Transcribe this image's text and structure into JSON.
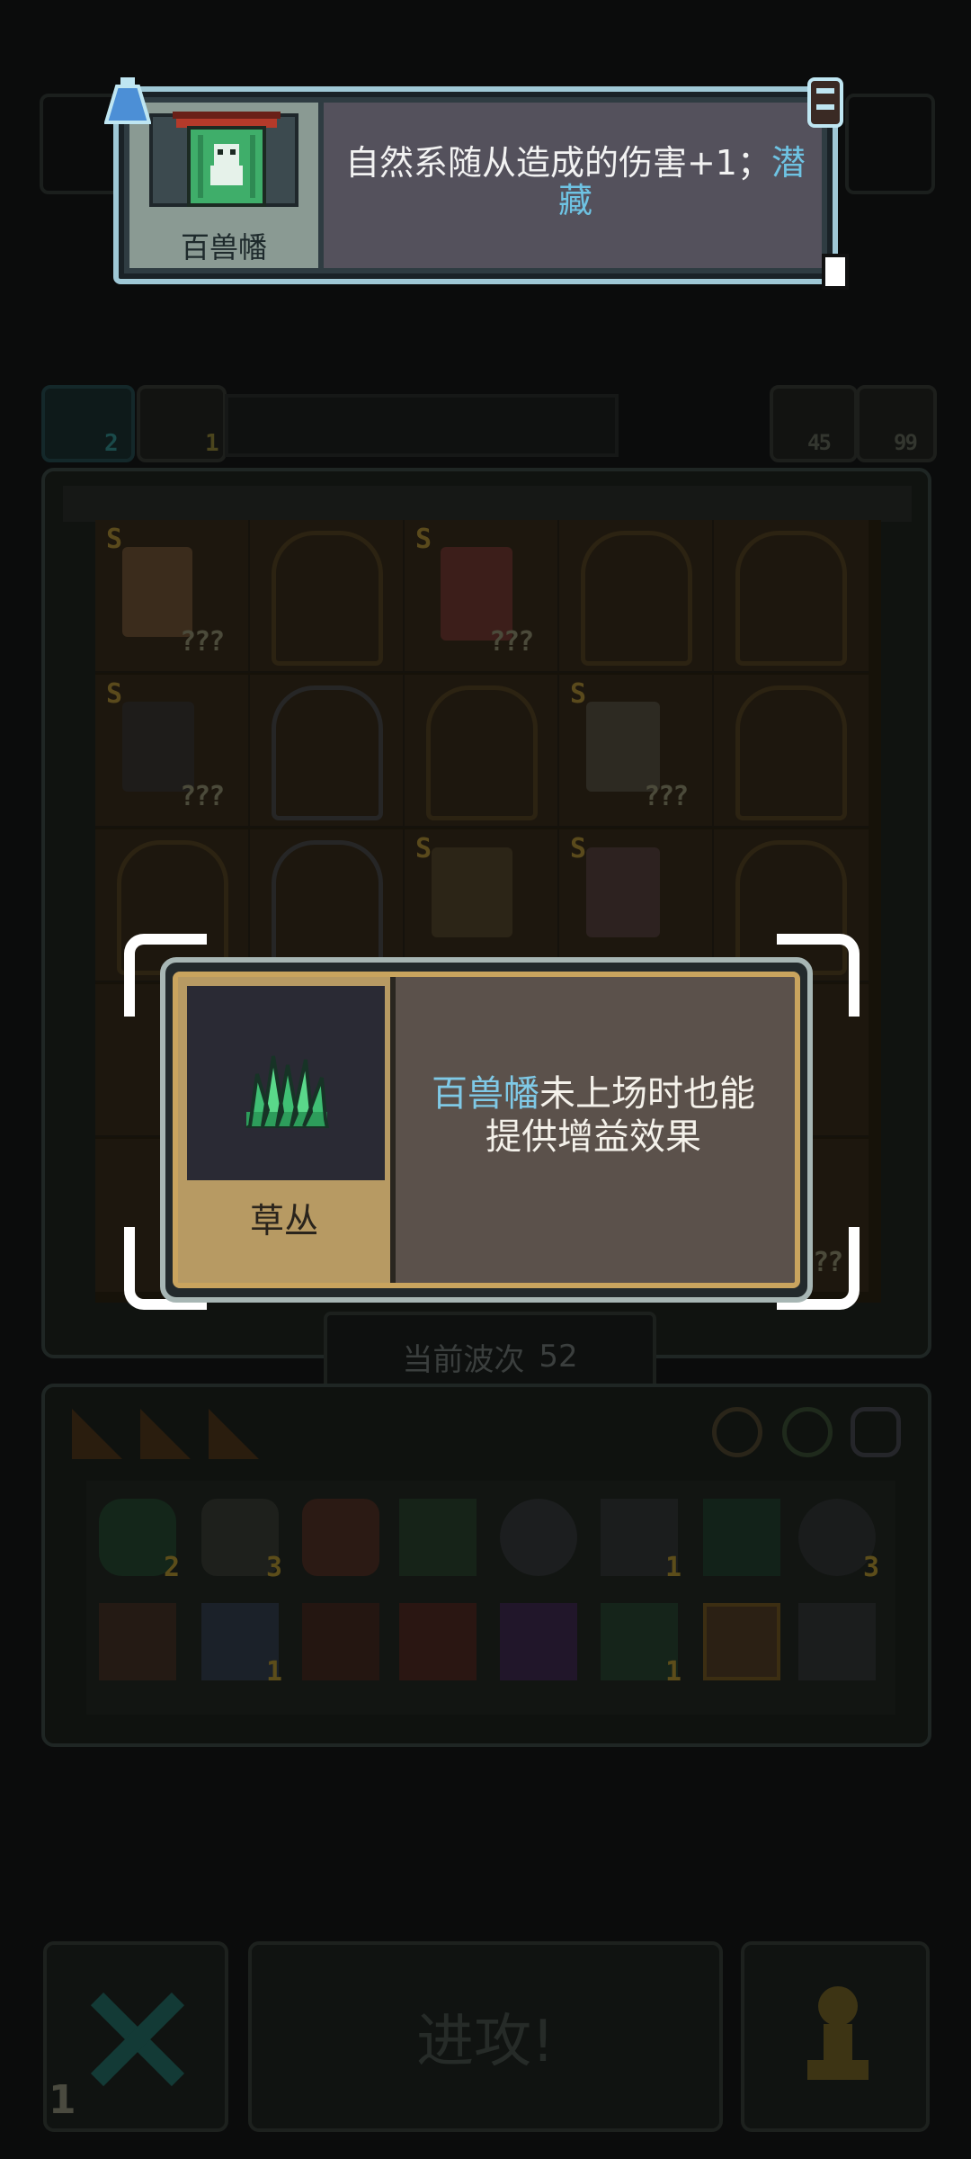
{
  "top_tooltip": {
    "item_name": "百兽幡",
    "desc_prefix": "自然系随从造成的伤害+1；",
    "desc_keyword_1": "潜",
    "desc_keyword_2": "藏",
    "keyword_color": "#6ec3e3"
  },
  "stats": {
    "left_icon_1_count": "2",
    "left_icon_2_count": "1",
    "right_icon_1_count": "45",
    "right_icon_2_count": "99"
  },
  "board": {
    "unknown_mark": "???",
    "rank_mark": "S"
  },
  "popup": {
    "item_name": "草丛",
    "desc_keyword": "百兽幡",
    "desc_line1_rest": "未上场时也能",
    "desc_line2": "提供增益效果",
    "keyword_color": "#7fc9e6"
  },
  "wave": {
    "label": "当前波次",
    "value": "52"
  },
  "inventory": {
    "counts": [
      "2",
      "3",
      "1",
      "3",
      "1",
      "1"
    ]
  },
  "bottom_bar": {
    "attack_label": "进攻!",
    "cancel_count": "1"
  },
  "colors": {
    "accent_cyan": "#7fc9e6",
    "gold": "#c9a45e",
    "panel_dark": "#54515c"
  }
}
